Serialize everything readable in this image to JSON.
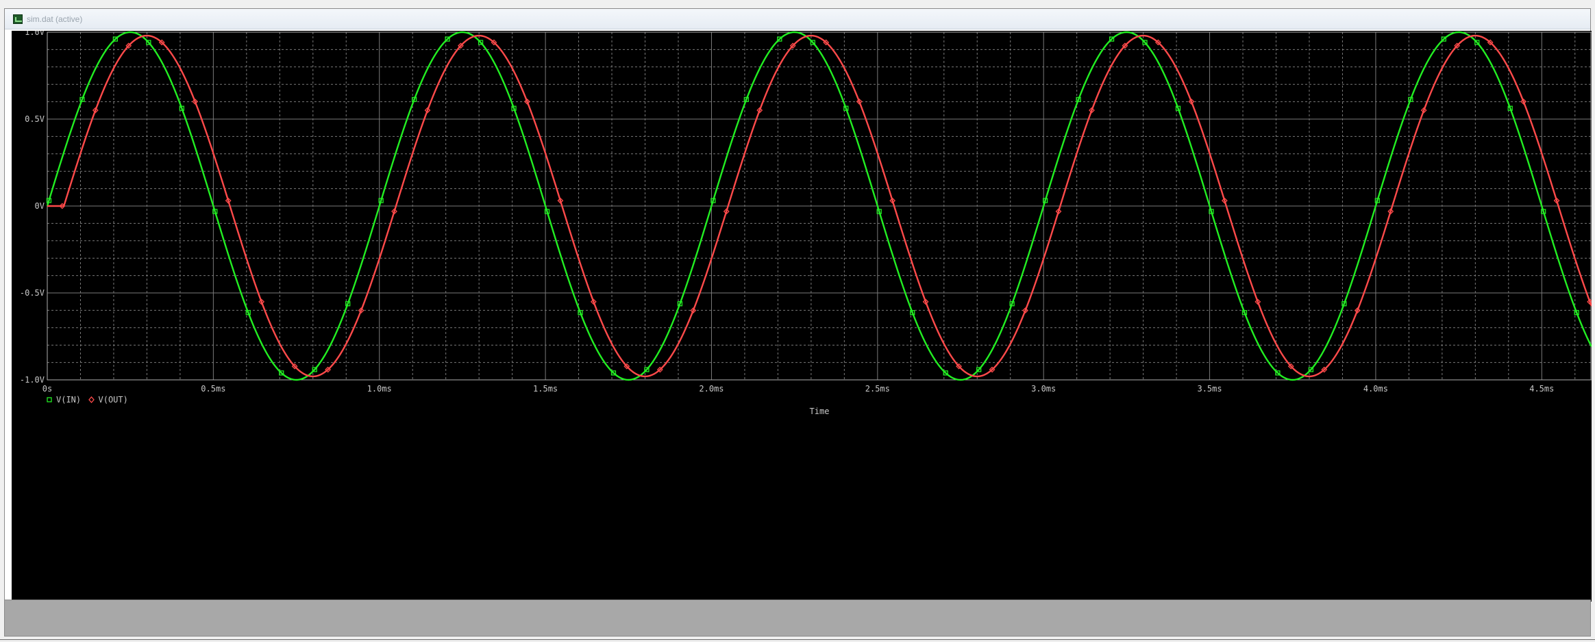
{
  "window": {
    "title": "sim.dat (active)"
  },
  "chart_data": {
    "type": "line",
    "xlabel": "Time",
    "ylabel": "",
    "xlim": [
      0,
      4.65
    ],
    "ylim": [
      -1.0,
      1.0
    ],
    "x_unit": "ms",
    "x_ticks": [
      0,
      0.5,
      1.0,
      1.5,
      2.0,
      2.5,
      3.0,
      3.5,
      4.0,
      4.5
    ],
    "x_tick_labels": [
      "0s",
      "0.5ms",
      "1.0ms",
      "1.5ms",
      "2.0ms",
      "2.5ms",
      "3.0ms",
      "3.5ms",
      "4.0ms",
      "4.5ms"
    ],
    "y_ticks": [
      1.0,
      0.5,
      0,
      -0.5,
      -1.0
    ],
    "y_tick_labels": [
      "1.0V",
      "0.5V",
      "0V",
      "-0.5V",
      "-1.0V"
    ],
    "grid": true,
    "legend": "bottom-left",
    "frequency_khz": 1.0,
    "series": [
      {
        "name": "V(IN)",
        "color": "#22ee22",
        "marker": "square",
        "amplitude": 1.0,
        "phase_lag_ms": 0
      },
      {
        "name": "V(OUT)",
        "color": "#ff4a4a",
        "marker": "diamond",
        "amplitude": 0.98,
        "phase_lag_ms": 0.05
      }
    ]
  },
  "colors": {
    "plot_background": "#000000",
    "grid_major": "#7a7a7a",
    "grid_minor": "#7a7a7a",
    "frame": "#b0b0b0",
    "status_panel": "#a8a8a8"
  },
  "icons": {
    "title_icon": "probe-window-icon"
  }
}
